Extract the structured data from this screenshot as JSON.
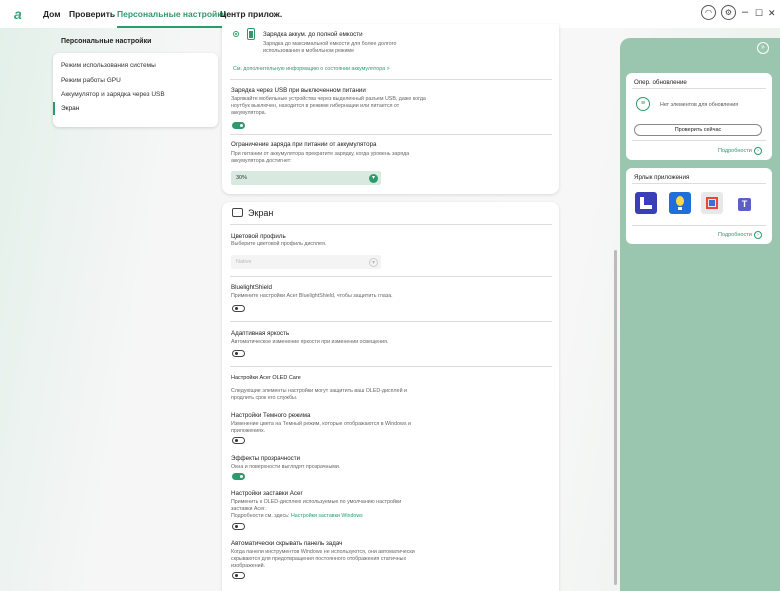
{
  "nav": {
    "logo": "a",
    "tabs": [
      "Дом",
      "Проверить",
      "Персональные настройки",
      "Центр прилож."
    ],
    "window_controls": [
      "–",
      "☐",
      "✕"
    ]
  },
  "sidebar": {
    "title": "Персональные настройки",
    "items": [
      "Режим использования системы",
      "Режим работы GPU",
      "Аккумулятор и зарядка через USB",
      "Экран"
    ]
  },
  "battery": {
    "full_charge_title": "Зарядка аккум. до полной емкости",
    "full_charge_desc": "Зарядка до максимальной емкости для более долгого использования в мобильном режиме",
    "more_info_link": "См. дополнительную информацию о состоянии аккумулятора >",
    "usb_title": "Зарядка через USB при выключенном питании",
    "usb_desc": "Заряжайте мобильные устройства через выделенный разъем USB, даже когда ноутбук выключен, находится в режиме гибернации или питается от аккумулятора.",
    "limit_title": "Ограничение заряда при питании от аккумулятора",
    "limit_desc": "При питании от аккумулятора прекратите зарядку, когда уровень заряда аккумулятора достигнет:",
    "limit_value": "30%"
  },
  "display": {
    "header": "Экран",
    "color_title": "Цветовой профиль",
    "color_desc": "Выберите цветовой профиль дисплея.",
    "color_value": "Native",
    "blue_title": "BluelightShield",
    "blue_desc": "Примените настройки Acer BluelightShield, чтобы защитить глаза.",
    "adaptive_title": "Адаптивная яркость",
    "adaptive_desc": "Автоматическое изменение яркости при изменении освещения.",
    "oled_title": "Настройки Acer OLED Care",
    "oled_desc": "Следующие элементы настройки могут защитить ваш OLED-дисплей и продлить срок его службы.",
    "dark_title": "Настройки Темного режима",
    "dark_desc": "Изменение цвета на Темный режим, которые отображаются в Windows и приложениях.",
    "transp_title": "Эффекты прозрачности",
    "transp_desc": "Окна и поверхности выглядят прозрачными.",
    "saver_title": "Настройки заставки Acer",
    "saver_desc": "Применить к OLED-дисплею используемые по умолчанию настройки заставки Acer.",
    "saver_more": "Подробности см. здесь:",
    "saver_link": "Настройки заставки Windows",
    "taskbar_title": "Автоматически скрывать панель задач",
    "taskbar_desc": "Когда панели инструментов Windows не используются, они автоматически скрываются для предотвращения постоянного отображения статичных изображений."
  },
  "right": {
    "update_title": "Опер. обновление",
    "update_status": "Нет элементов для обновления",
    "check_button": "Проверить сейчас",
    "details": "Подробности",
    "apps_title": "Ярлык приложения",
    "apps": [
      "app-icon-1",
      "app-icon-2",
      "app-icon-3",
      "teams-icon"
    ],
    "app_colors": [
      "#3a3fb8",
      "#1e6fd9",
      "#e8453c",
      "#5b5fc7"
    ]
  }
}
